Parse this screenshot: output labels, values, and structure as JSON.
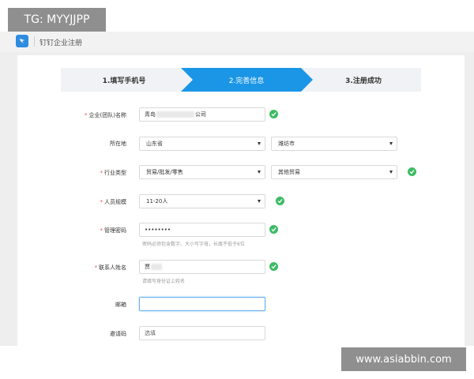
{
  "watermark_top": "TG: MYYJJPP",
  "watermark_bottom": "www.asiabbin.com",
  "app": {
    "title": "钉钉企业注册",
    "logo_icon": "dingtalk-logo-icon",
    "accent": "#1b96e6"
  },
  "steps": [
    {
      "label": "1.填写手机号",
      "active": false
    },
    {
      "label": "2.完善信息",
      "active": true
    },
    {
      "label": "3.注册成功",
      "active": false
    }
  ],
  "form": {
    "company": {
      "label": "企业(团队)名称",
      "required": true,
      "value_prefix": "青岛",
      "value_suffix": "公司",
      "valid": true
    },
    "location": {
      "label": "所在地",
      "required": false,
      "province": "山东省",
      "city": "潍坊市"
    },
    "industry": {
      "label": "行业类型",
      "required": true,
      "primary": "贸易/批发/零售",
      "secondary": "其他贸易",
      "valid": true
    },
    "size": {
      "label": "人员规模",
      "required": true,
      "value": "11-20人",
      "valid": true
    },
    "password": {
      "label": "管理密码",
      "required": true,
      "value": "••••••••",
      "hint": "密码必须包含数字、大小写字母，长度不低于6位",
      "valid": true
    },
    "contact": {
      "label": "联系人姓名",
      "required": true,
      "value": "贾",
      "hint": "请填写身份证上姓名",
      "valid": true
    },
    "email": {
      "label": "邮箱",
      "required": false,
      "value": ""
    },
    "invite": {
      "label": "邀请码",
      "required": false,
      "placeholder": "选填"
    }
  },
  "colors": {
    "step_active": "#1b96e6",
    "step_inactive": "#f0f2f5",
    "check": "#3dbb63",
    "required": "#e05050"
  }
}
